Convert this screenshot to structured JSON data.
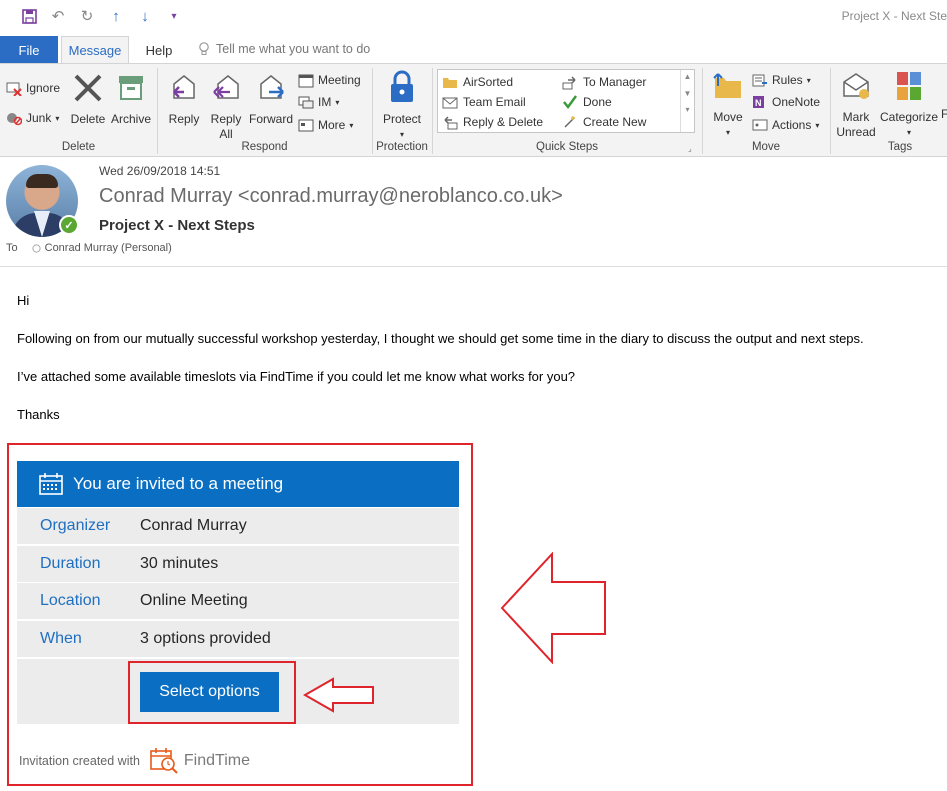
{
  "window": {
    "title": "Project X - Next Ste"
  },
  "tabs": {
    "file": "File",
    "message": "Message",
    "help": "Help",
    "tellme": "Tell me what you want to do"
  },
  "ribbon": {
    "delete_group": {
      "label": "Delete",
      "ignore": "Ignore",
      "junk": "Junk",
      "delete": "Delete",
      "archive": "Archive"
    },
    "respond_group": {
      "label": "Respond",
      "reply": "Reply",
      "reply_all_1": "Reply",
      "reply_all_2": "All",
      "forward": "Forward",
      "meeting": "Meeting",
      "im": "IM",
      "more": "More"
    },
    "protection_group": {
      "label": "Protection",
      "protect": "Protect"
    },
    "quicksteps_group": {
      "label": "Quick Steps",
      "items": [
        "AirSorted",
        "Team Email",
        "Reply & Delete",
        "To Manager",
        "Done",
        "Create New"
      ]
    },
    "move_group": {
      "label": "Move",
      "move": "Move",
      "rules": "Rules",
      "onenote": "OneNote",
      "actions": "Actions"
    },
    "tags_group": {
      "label": "Tags",
      "mark_unread_1": "Mark",
      "mark_unread_2": "Unread",
      "categorize": "Categorize",
      "follow": "F"
    }
  },
  "header": {
    "date": "Wed 26/09/2018 14:51",
    "from": "Conrad Murray <conrad.murray@neroblanco.co.uk>",
    "subject": "Project X - Next Steps",
    "to_label": "To",
    "to_value": "Conrad Murray (Personal)"
  },
  "body": {
    "greeting": "Hi",
    "para1": "Following on from our mutually successful workshop yesterday, I thought we should get some time in the diary to discuss the output and next steps.",
    "para2": "I’ve attached some available timeslots via FindTime if you could let me know what works for you?",
    "signoff": "Thanks"
  },
  "invite": {
    "title": "You are invited to a meeting",
    "rows": [
      {
        "key": "Organizer",
        "value": "Conrad Murray"
      },
      {
        "key": "Duration",
        "value": "30 minutes"
      },
      {
        "key": "Location",
        "value": "Online Meeting"
      },
      {
        "key": "When",
        "value": "3 options provided"
      }
    ],
    "button": "Select options",
    "footer_text": "Invitation created with",
    "footer_brand": "FindTime"
  },
  "colors": {
    "accent": "#0a6fc2",
    "highlight": "#e0242c",
    "file_tab": "#2b6cc4"
  },
  "icons": [
    "save-icon",
    "undo-icon",
    "redo-icon",
    "up-icon",
    "down-icon",
    "lightbulb-icon",
    "calendar-icon",
    "findtime-icon",
    "presence-available-icon"
  ]
}
